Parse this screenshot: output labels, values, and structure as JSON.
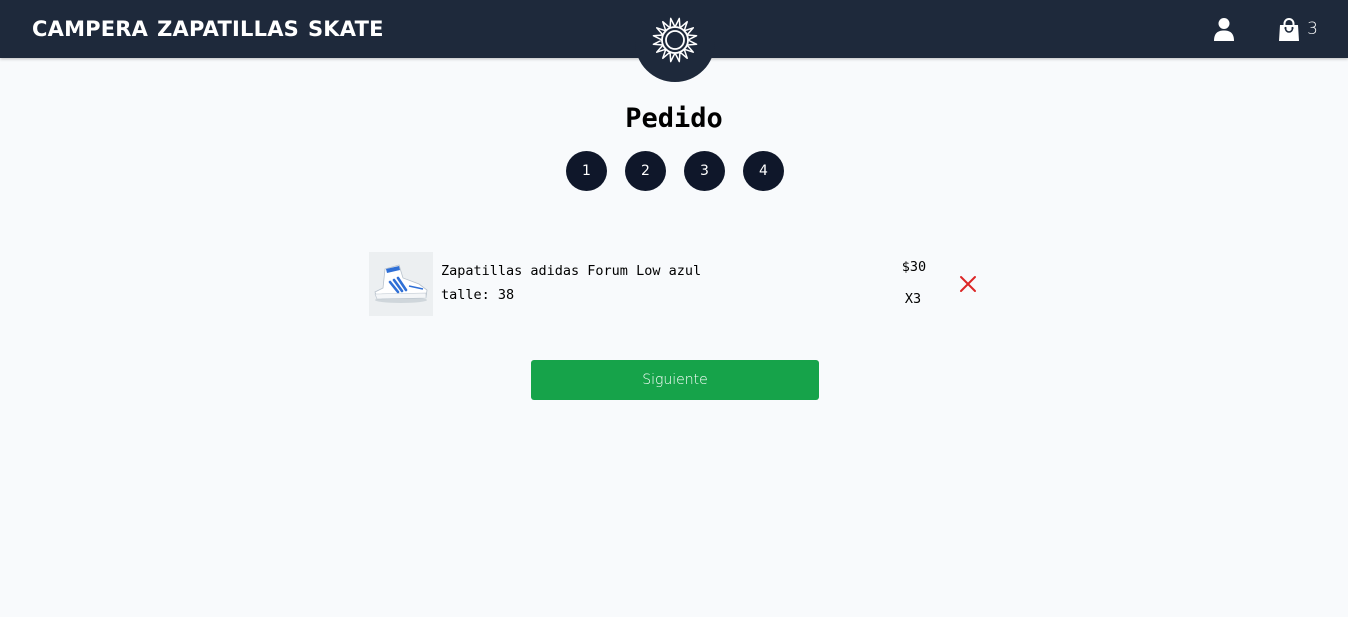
{
  "nav": {
    "links": [
      "CAMPERA",
      "ZAPATILLAS",
      "SKATE"
    ],
    "cart_count": "3",
    "icons": {
      "logo": "sun-emblem-icon",
      "user": "user-icon",
      "cart": "shopping-bag-icon"
    }
  },
  "page": {
    "title": "Pedido",
    "steps": [
      "1",
      "2",
      "3",
      "4"
    ]
  },
  "cart": {
    "items": [
      {
        "name": "Zapatillas adidas Forum Low azul",
        "size": "talle: 38",
        "price": "$30",
        "quantity": "X3",
        "image": "sneaker-thumbnail"
      }
    ]
  },
  "actions": {
    "next_label": "Siguiente"
  },
  "colors": {
    "navbar": "#1e293b",
    "background": "#f8fafc",
    "step": "#0f172a",
    "next_button": "#16a34a",
    "remove": "#dc2626"
  }
}
